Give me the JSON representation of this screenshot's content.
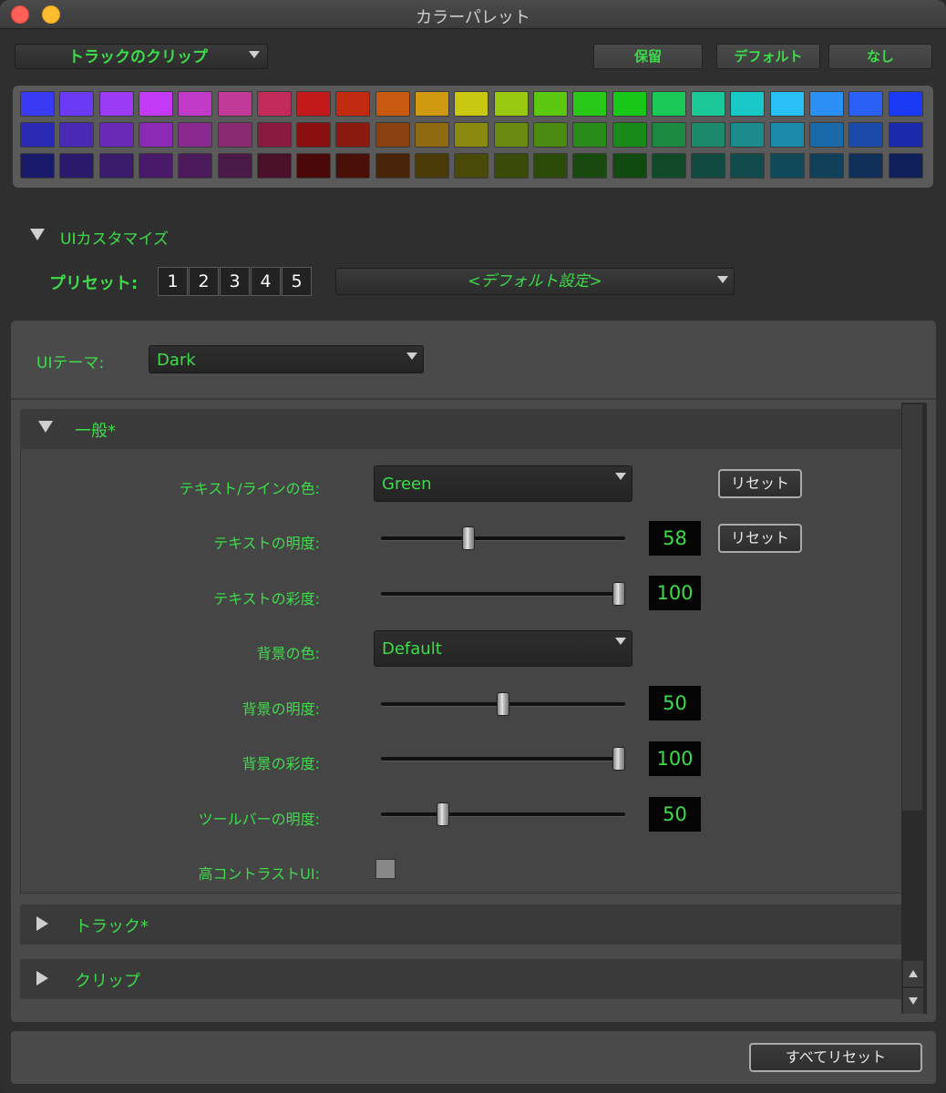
{
  "window": {
    "title": "カラーパレット"
  },
  "toolbar": {
    "clip_select_value": "トラックのクリップ",
    "hold_label": "保留",
    "default_label": "デフォルト",
    "none_label": "なし"
  },
  "palette": {
    "rows": [
      [
        "#3a3af5",
        "#6a3af5",
        "#9a3af5",
        "#c23af5",
        "#c23ac8",
        "#c23a98",
        "#c22a5a",
        "#c21a1a",
        "#c22a10",
        "#c85a10",
        "#d09a10",
        "#c8c810",
        "#98c810",
        "#5ac810",
        "#28c818",
        "#18c818",
        "#1ac858",
        "#1ac898",
        "#18c8c8",
        "#28c0f5",
        "#2a90f5",
        "#2a60f5",
        "#1a3af5"
      ],
      [
        "#2a2ab5",
        "#4a2ab5",
        "#6a2ab5",
        "#8a2ab5",
        "#8a2a90",
        "#8a2a70",
        "#8a1a40",
        "#8a1010",
        "#8a1a10",
        "#8a4010",
        "#906a10",
        "#8a8a10",
        "#6a8a10",
        "#4a8a10",
        "#288a18",
        "#188a18",
        "#1a8a40",
        "#1a8a6a",
        "#1a8a8a",
        "#1a8aaa",
        "#1a6aaa",
        "#1a4aaa",
        "#1a2aaa"
      ],
      [
        "#1a1a6a",
        "#2a1a6a",
        "#3a1a6a",
        "#4a1a6a",
        "#4a1a5a",
        "#4a1a48",
        "#4a1028",
        "#4a0808",
        "#4a1008",
        "#4a2408",
        "#4a3a08",
        "#4a4a08",
        "#3a4a08",
        "#2a4a08",
        "#184a10",
        "#104a10",
        "#104a28",
        "#104a40",
        "#104a4a",
        "#104a5a",
        "#10405a",
        "#10305a",
        "#10205a"
      ]
    ]
  },
  "ui_customize": {
    "title": "UIカスタマイズ",
    "preset_label": "プリセット:",
    "presets": [
      "1",
      "2",
      "3",
      "4",
      "5"
    ],
    "preset_select_value": "<デフォルト設定>"
  },
  "theme": {
    "label": "UIテーマ:",
    "value": "Dark"
  },
  "general": {
    "title": "一般*",
    "text_color_label": "テキスト/ラインの色:",
    "text_color_value": "Green",
    "text_brightness_label": "テキストの明度:",
    "text_brightness_value": "58",
    "text_brightness_fraction": 0.35,
    "text_saturation_label": "テキストの彩度:",
    "text_saturation_value": "100",
    "text_saturation_fraction": 1.0,
    "bg_color_label": "背景の色:",
    "bg_color_value": "Default",
    "bg_brightness_label": "背景の明度:",
    "bg_brightness_value": "50",
    "bg_brightness_fraction": 0.5,
    "bg_saturation_label": "背景の彩度:",
    "bg_saturation_value": "100",
    "bg_saturation_fraction": 1.0,
    "toolbar_brightness_label": "ツールバーの明度:",
    "toolbar_brightness_value": "50",
    "toolbar_brightness_fraction": 0.24,
    "high_contrast_label": "高コントラストUI:",
    "reset_label": "リセット"
  },
  "sections": {
    "track_title": "トラック*",
    "clip_title": "クリップ"
  },
  "footer": {
    "reset_all_label": "すべてリセット"
  },
  "colors": {
    "accent_green": "#3ddc4a"
  }
}
